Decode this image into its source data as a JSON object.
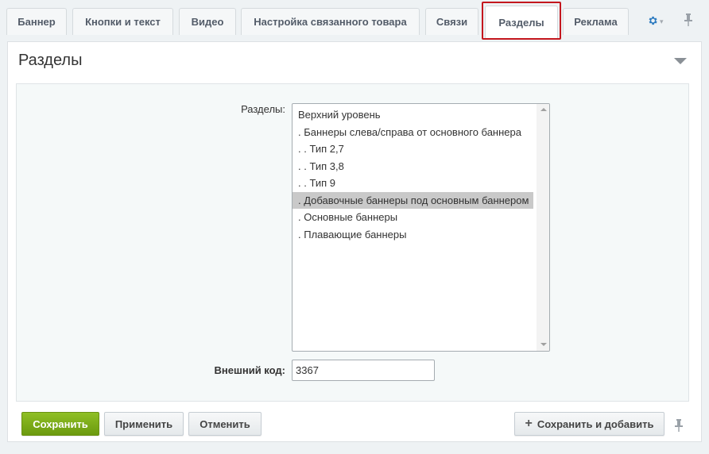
{
  "tabs": [
    {
      "label": "Баннер"
    },
    {
      "label": "Кнопки и текст"
    },
    {
      "label": "Видео"
    },
    {
      "label": "Настройка связанного товара"
    },
    {
      "label": "Связи"
    },
    {
      "label": "Разделы",
      "active": true
    },
    {
      "label": "Реклама"
    }
  ],
  "tab_icons": {
    "settings": "gear-icon",
    "pin": "pin-icon"
  },
  "panel": {
    "title": "Разделы",
    "sections_label": "Разделы:",
    "sections_list": [
      "Верхний уровень",
      ". Баннеры слева/справа от основного баннера",
      ". . Тип 2,7",
      ". . Тип 3,8",
      ". . Тип 9",
      ". Добавочные баннеры под основным баннером",
      ". Основные баннеры",
      ". Плавающие баннеры"
    ],
    "selected_section": ". Добавочные баннеры под основным баннером",
    "external_code_label": "Внешний код:",
    "external_code_value": "3367"
  },
  "footer": {
    "save": "Сохранить",
    "apply": "Применить",
    "cancel": "Отменить",
    "save_and_add": "Сохранить и добавить"
  },
  "colors": {
    "primary_button": "#7aab19",
    "active_tab_outline": "#c4171e",
    "gear_icon": "#2d7bc0",
    "selected_item": "#c9c9c9"
  }
}
